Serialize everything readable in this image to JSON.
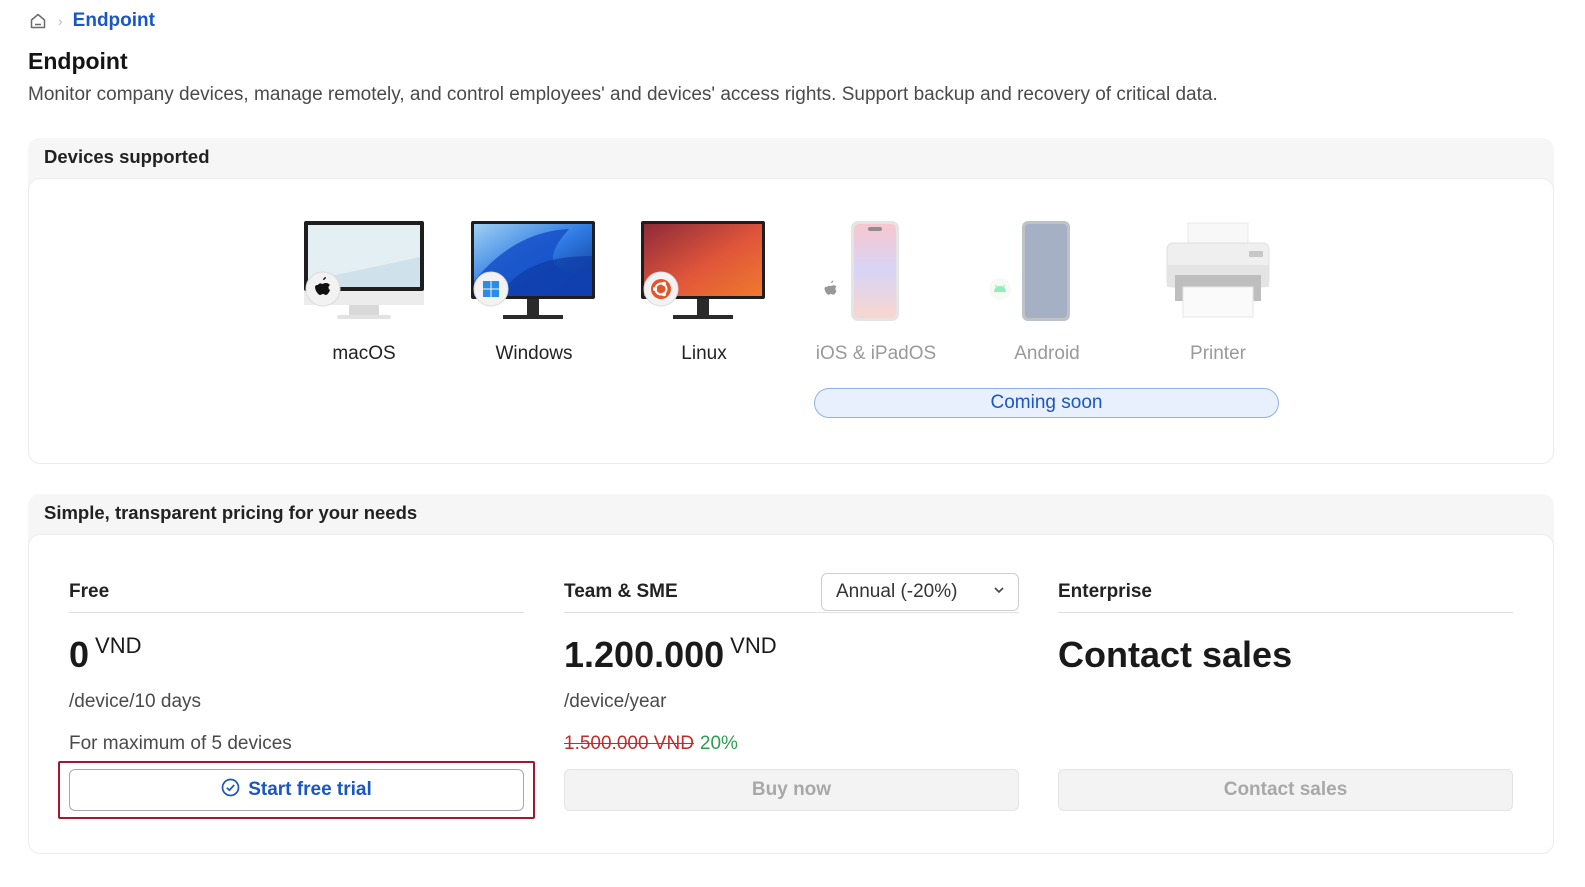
{
  "breadcrumb": {
    "current": "Endpoint"
  },
  "header": {
    "title": "Endpoint",
    "description": "Monitor company devices, manage remotely, and control employees' and devices' access rights. Support backup and recovery of critical data."
  },
  "devices_section": {
    "title": "Devices supported",
    "devices": [
      {
        "label": "macOS",
        "icon": "imac-apple-icon",
        "available": true
      },
      {
        "label": "Windows",
        "icon": "monitor-windows-icon",
        "available": true
      },
      {
        "label": "Linux",
        "icon": "monitor-ubuntu-icon",
        "available": true
      },
      {
        "label": "iOS & iPadOS",
        "icon": "iphone-icon",
        "available": false
      },
      {
        "label": "Android",
        "icon": "android-phone-icon",
        "available": false
      },
      {
        "label": "Printer",
        "icon": "printer-icon",
        "available": false
      }
    ],
    "coming_soon_label": "Coming soon"
  },
  "pricing_section": {
    "title": "Simple, transparent pricing for your needs",
    "plans": [
      {
        "name": "Free",
        "amount": "0",
        "currency": "VND",
        "period": "/device/10 days",
        "note": "For maximum of 5 devices",
        "button_label": "Start free trial"
      },
      {
        "name": "Team & SME",
        "billing_select": "Annual (-20%)",
        "amount": "1.200.000",
        "currency": "VND",
        "period": "/device/year",
        "old_price": "1.500.000 VND",
        "discount": "20%",
        "button_label": "Buy now"
      },
      {
        "name": "Enterprise",
        "amount": "Contact sales",
        "button_label": "Contact sales"
      }
    ]
  },
  "colors": {
    "accent": "#1a56c4",
    "highlight": "#a3182e",
    "strike": "#c42a2a",
    "discount": "#2e9e4e"
  }
}
